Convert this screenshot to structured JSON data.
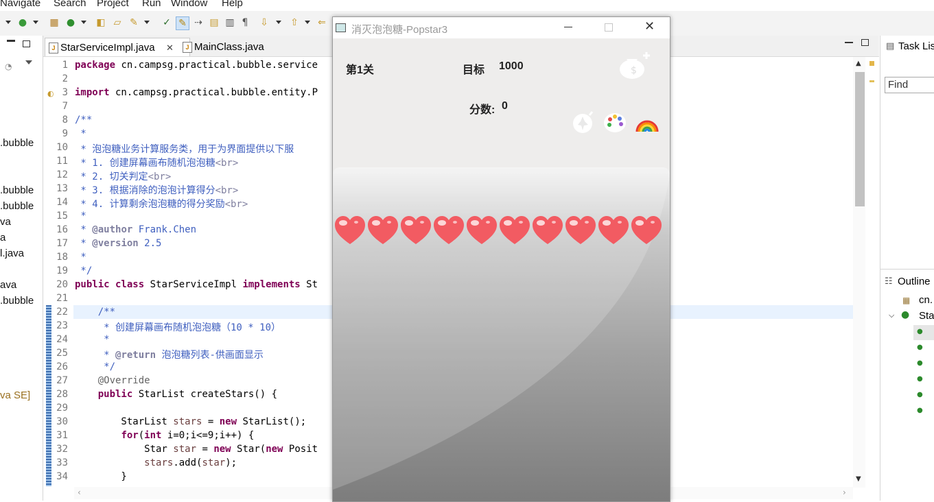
{
  "menu": [
    "Navigate",
    "Search",
    "Project",
    "Run",
    "Window",
    "Help"
  ],
  "left_panel": {
    "items": [
      ".bubble",
      ".bubble",
      ".bubble",
      "va",
      "a",
      "l.java",
      "ava",
      ".bubble",
      "va SE]"
    ]
  },
  "editor": {
    "tabs": [
      {
        "label": "StarServiceImpl.java",
        "active": true
      },
      {
        "label": "MainClass.java",
        "active": false
      }
    ],
    "line_numbers": [
      "1",
      "2",
      "3",
      "7",
      "8",
      "9",
      "10",
      "11",
      "12",
      "13",
      "14",
      "15",
      "16",
      "17",
      "18",
      "19",
      "20",
      "21",
      "22",
      "23",
      "24",
      "25",
      "26",
      "27",
      "28",
      "29",
      "30",
      "31",
      "32",
      "33",
      "34"
    ]
  },
  "right_panel": {
    "task_list_title": "Task Lis",
    "find_placeholder": "Find",
    "outline_title": "Outline",
    "outline_items": [
      "cn.",
      "Sta"
    ]
  },
  "game": {
    "window_title": "消灭泡泡糖-Popstar3",
    "level": "第1关",
    "target_label": "目标",
    "target_value": "1000",
    "score_label": "分数:",
    "score_value": "0",
    "heart_count": 10,
    "colors": {
      "heart": "#f25b62",
      "stage_top": "#f2f2f2",
      "stage_bottom": "#7c7c7c"
    }
  },
  "colors": {
    "keyword": "#7f0055",
    "comment": "#3f5fbf",
    "current_line": "#e8f2fe"
  }
}
